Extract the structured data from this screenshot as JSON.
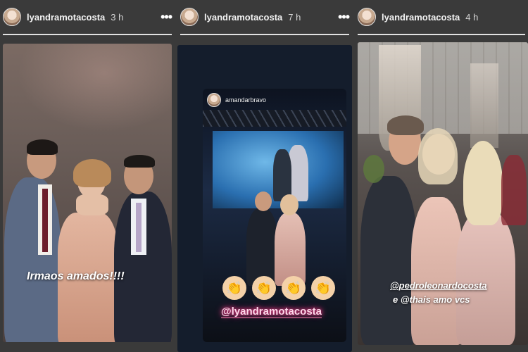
{
  "stories": [
    {
      "username": "lyandramotacosta",
      "time": "3 h",
      "menu_icon": "more-dots-icon",
      "caption": "Irmaos amados!!!!"
    },
    {
      "username": "lyandramotacosta",
      "time": "7 h",
      "menu_icon": "more-dots-icon",
      "repost_user": "amandarbravo",
      "mention": "@lyandramotacosta",
      "emoji": "clapping-hands-icon"
    },
    {
      "username": "lyandramotacosta",
      "time": "4 h",
      "menu_icon": "more-dots-icon",
      "caption_line1": "@pedroleonardocosta",
      "caption_line2": "e @thais amo vcs"
    }
  ],
  "colors": {
    "background": "#3a3a3a",
    "dress_rose": "#d9a891",
    "suit_navy": "#2b3140",
    "neon_pink": "#ff3c8a",
    "stage_blue": "#2a6fb0"
  }
}
